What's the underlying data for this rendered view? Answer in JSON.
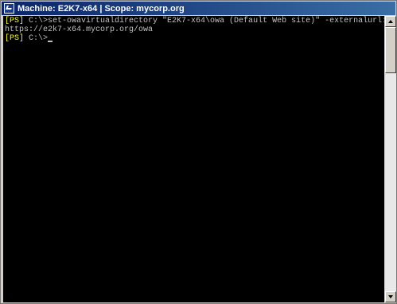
{
  "window": {
    "title": "Machine: E2K7-x64 | Scope: mycorp.org",
    "icon": "powershell-icon"
  },
  "console": {
    "lines": [
      {
        "prompt": "[PS]",
        "text": " C:\\>set-owavirtualdirectory \"E2K7-x64\\owa (Default Web site)\" -externalurl:"
      },
      {
        "prompt": "",
        "text": "https://e2k7-x64.mycorp.org/owa"
      },
      {
        "prompt": "[PS]",
        "text": " C:\\>"
      }
    ],
    "prompt_color": "#ffff00",
    "text_color": "#c0c0c0",
    "background": "#000000"
  },
  "scrollbar": {
    "up_icon": "arrow-up-icon",
    "down_icon": "arrow-down-icon"
  }
}
